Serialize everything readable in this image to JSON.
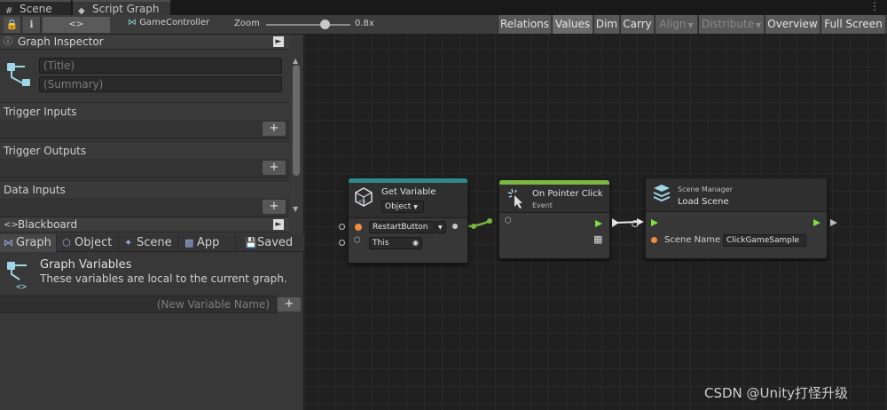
{
  "tabs": [
    {
      "label": "Scene",
      "icon": "hash-icon"
    },
    {
      "label": "Script Graph",
      "icon": "graph-icon"
    }
  ],
  "toolbar": {
    "lock_icon": "lock-icon",
    "info_icon": "info-icon",
    "code_icon": "code-icon",
    "object_name": "GameController",
    "zoom_label": "Zoom",
    "zoom_value": "0.8x",
    "zoom_level": 0.7,
    "buttons": [
      {
        "label": "Relations",
        "enabled": true,
        "selected": false
      },
      {
        "label": "Values",
        "enabled": true,
        "selected": true
      },
      {
        "label": "Dim",
        "enabled": true,
        "selected": false
      },
      {
        "label": "Carry",
        "enabled": true,
        "selected": false
      },
      {
        "label": "Align",
        "enabled": false,
        "dropdown": true
      },
      {
        "label": "Distribute",
        "enabled": false,
        "dropdown": true
      },
      {
        "label": "Overview",
        "enabled": true,
        "selected": false
      },
      {
        "label": "Full Screen",
        "enabled": true,
        "selected": false
      }
    ]
  },
  "inspector": {
    "title": "Graph Inspector",
    "title_placeholder": "(Title)",
    "summary_placeholder": "(Summary)",
    "sections": [
      "Trigger Inputs",
      "Trigger Outputs",
      "Data Inputs"
    ],
    "add_label": "+"
  },
  "blackboard": {
    "title": "Blackboard",
    "tabs": [
      {
        "label": "Graph",
        "selected": true
      },
      {
        "label": "Object",
        "selected": false
      },
      {
        "label": "Scene",
        "selected": false
      },
      {
        "label": "App",
        "selected": false
      },
      {
        "label": "Saved",
        "selected": false
      }
    ],
    "section_title": "Graph Variables",
    "section_desc": "These variables are local to the current graph.",
    "new_var_placeholder": "(New Variable Name)",
    "add_label": "+"
  },
  "nodes": {
    "get_variable": {
      "title": "Get Variable",
      "kind": "Object",
      "name_value": "RestartButton",
      "target_value": "This",
      "accent": "#2e8a8a"
    },
    "on_pointer_click": {
      "title": "On Pointer Click",
      "subtitle": "Event",
      "accent": "#7ab640"
    },
    "load_scene": {
      "subtitle": "Scene Manager",
      "title": "Load Scene",
      "param_label": "Scene Name",
      "param_value": "ClickGameSample"
    }
  },
  "colors": {
    "control_flow": "#7ee03c",
    "object_port": "#f18b3e",
    "data_link": "#7ab640"
  },
  "watermark": "CSDN @Unity打怪升级"
}
